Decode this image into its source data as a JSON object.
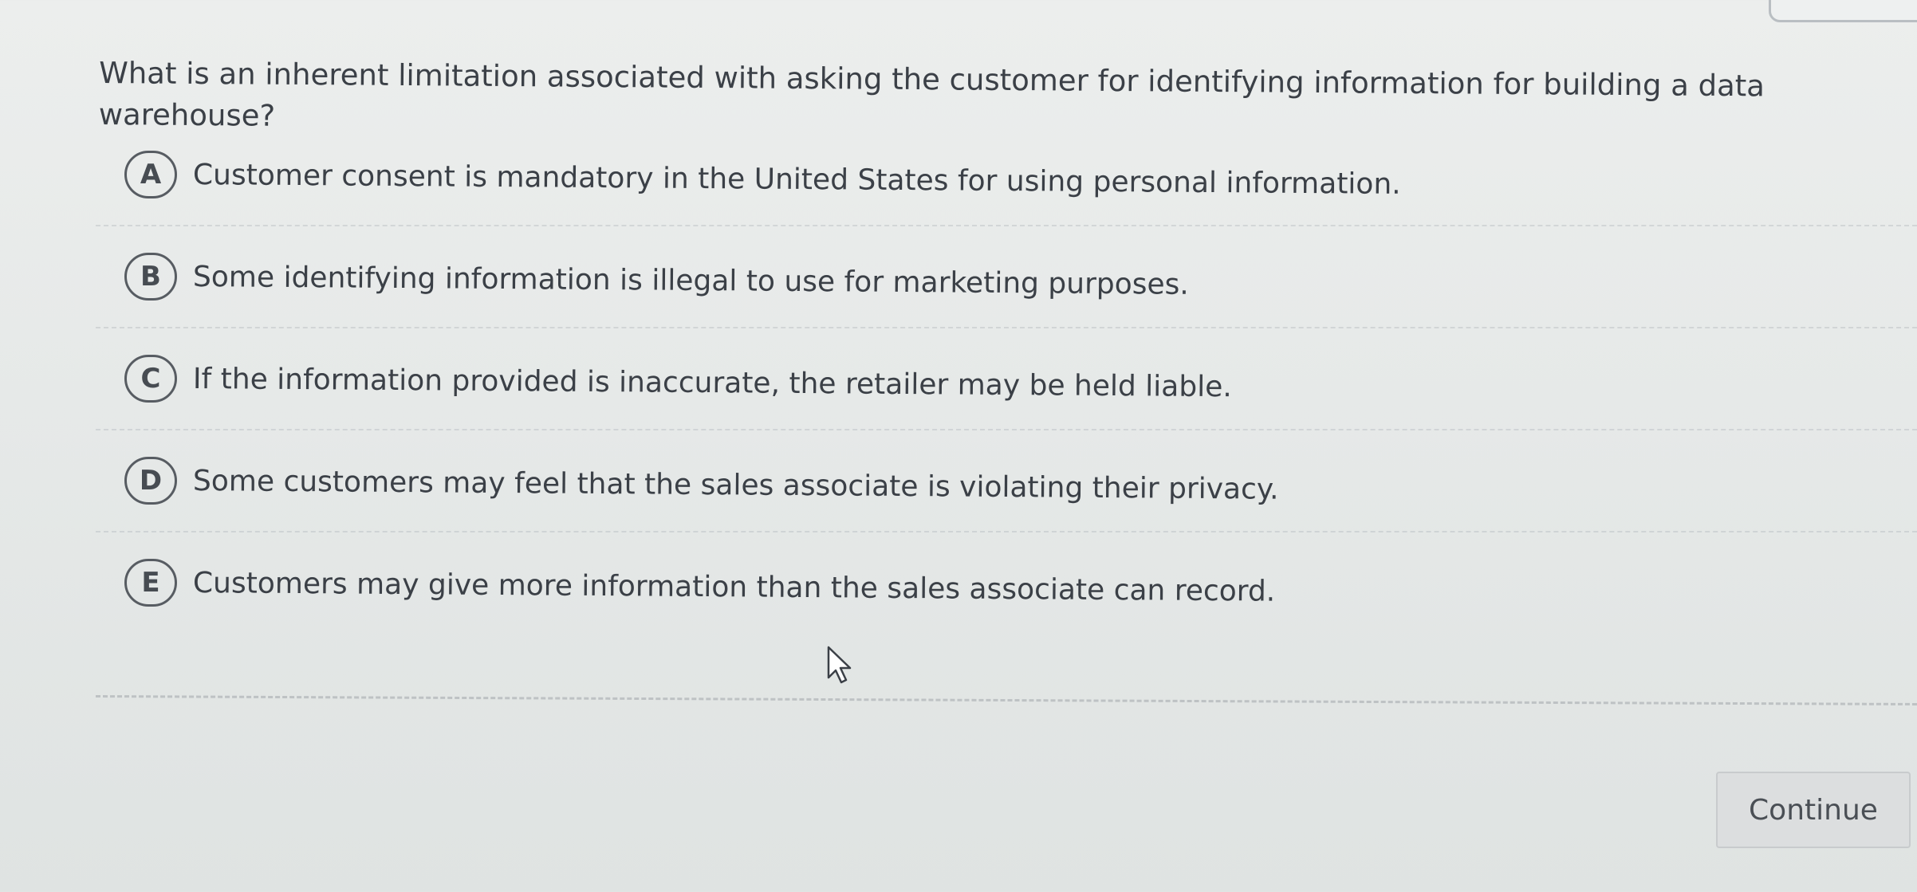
{
  "question": {
    "text": "What is an inherent limitation associated with asking the customer for identifying information for building a data warehouse?"
  },
  "options": [
    {
      "letter": "A",
      "text": "Customer consent is mandatory in the United States for using personal information."
    },
    {
      "letter": "B",
      "text": "Some identifying information is illegal to use for marketing purposes."
    },
    {
      "letter": "C",
      "text": "If the information provided is inaccurate, the retailer may be held liable."
    },
    {
      "letter": "D",
      "text": "Some customers may feel that the sales associate is violating their privacy."
    },
    {
      "letter": "E",
      "text": "Customers may give more information than the sales associate can record."
    }
  ],
  "actions": {
    "continue_label": "Continue"
  },
  "icons": {
    "cursor": "mouse-pointer-icon"
  }
}
